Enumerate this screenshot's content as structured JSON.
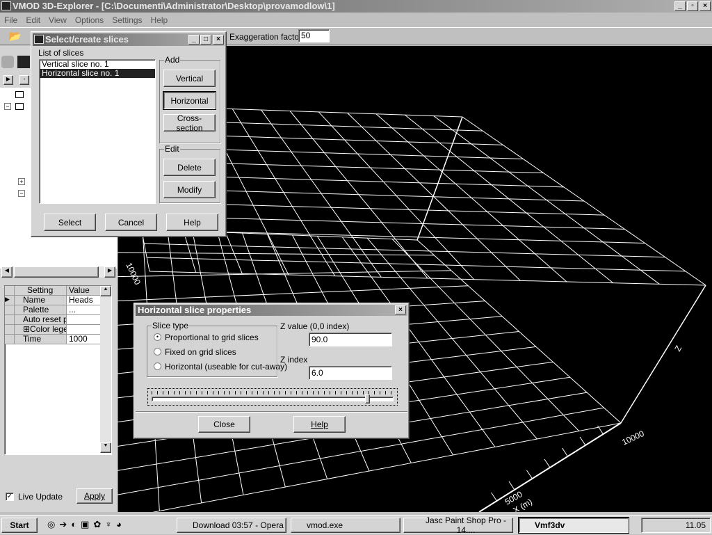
{
  "app": {
    "title": "VMOD 3D-Explorer - [C:\\Documenti\\Administrator\\Desktop\\provamodlow\\1]",
    "menu": [
      "File",
      "Edit",
      "View",
      "Options",
      "Settings",
      "Help"
    ],
    "exaggeration_label": "Exaggeration factor",
    "exaggeration_value": "50"
  },
  "slices_dialog": {
    "title": "Select/create slices",
    "list_label": "List of slices",
    "items": [
      "Vertical slice no. 1",
      "Horizontal slice no. 1"
    ],
    "selected_index": 1,
    "add_label": "Add",
    "vertical": "Vertical",
    "horizontal": "Horizontal",
    "cross_section": "Cross-section",
    "edit_label": "Edit",
    "delete": "Delete",
    "modify": "Modify",
    "select": "Select",
    "cancel": "Cancel",
    "help": "Help"
  },
  "props": {
    "headers": [
      "Setting",
      "Value"
    ],
    "rows": [
      {
        "setting": "Name",
        "value": "Heads"
      },
      {
        "setting": "Palette",
        "value": "..."
      },
      {
        "setting": "Auto reset pa",
        "value": ""
      },
      {
        "setting": "⊞Color legend",
        "value": ""
      },
      {
        "setting": "Time",
        "value": "1000"
      }
    ],
    "live_update": "Live Update",
    "live_update_checked": true,
    "apply": "Apply"
  },
  "hslice": {
    "title": "Horizontal slice properties",
    "slice_type_label": "Slice type",
    "options": [
      "Proportional to grid slices",
      "Fixed on grid slices",
      "Horizontal (useable for cut-away)"
    ],
    "selected_option": 0,
    "z_value_label": "Z value (0,0 index)",
    "z_value": "90.0",
    "z_index_label": "Z index",
    "z_index": "6.0",
    "slider_fraction": 0.9,
    "close": "Close",
    "help": "Help"
  },
  "view3d": {
    "labels": {
      "y_max": "10000",
      "x_max": "10000",
      "x_mid": "5000",
      "x_axis": "X (m)",
      "z_axis": "Z"
    },
    "background": "#000000",
    "grid_color": "#ffffff"
  },
  "taskbar": {
    "start": "Start",
    "tasks": [
      "Download 03:57 - Opera",
      "vmod.exe",
      "Jasc Paint Shop Pro - 14....",
      "Vmf3dv"
    ],
    "active_task": 3,
    "clock": "11.05"
  }
}
